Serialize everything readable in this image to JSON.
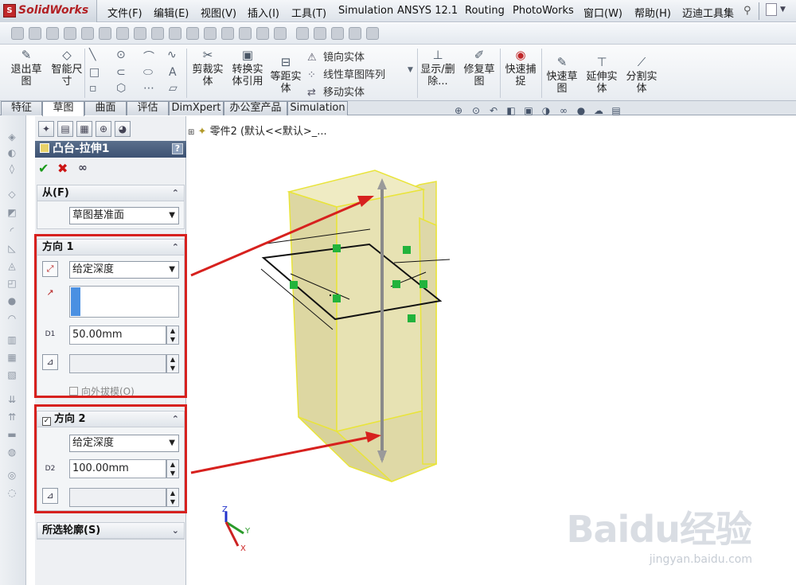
{
  "app": {
    "name": "SolidWorks",
    "logo_mark": "S"
  },
  "menu": [
    "文件(F)",
    "编辑(E)",
    "视图(V)",
    "插入(I)",
    "工具(T)",
    "Simulation",
    "ANSYS 12.1",
    "Routing",
    "PhotoWorks",
    "窗口(W)",
    "帮助(H)",
    "迈迪工具集"
  ],
  "command_manager": {
    "exit_sketch": "退出草图",
    "smart_dim": "智能尺寸",
    "trim": "剪裁实体",
    "convert": "转换实体引用",
    "offset": "等距实体",
    "mirror": "镜向实体",
    "linear_pattern": "线性草图阵列",
    "move": "移动实体",
    "display_delete": "显示/删除...",
    "repair": "修复草图",
    "quick_snap": "快速捕捉",
    "quick_sketch": "快速草图",
    "extend": "延伸实体",
    "split": "分割实体"
  },
  "tabs": [
    "特征",
    "草图",
    "曲面",
    "评估",
    "DimXpert",
    "办公室产品",
    "Simulation"
  ],
  "active_tab": "草图",
  "panel": {
    "title": "凸台-拉伸1",
    "help": "?",
    "from": {
      "header": "从(F)",
      "value": "草图基准面"
    },
    "dir1": {
      "header": "方向 1",
      "type": "给定深度",
      "depth": "50.00mm",
      "depth_icon_label": "D1",
      "draft_label": "向外拔模(O)"
    },
    "dir2": {
      "header": "方向 2",
      "type": "给定深度",
      "depth": "100.00mm",
      "depth_icon_label": "D2"
    },
    "selected_contours": {
      "header": "所选轮廓(S)"
    }
  },
  "tree": {
    "label": "零件2  (默认<<默认>_..."
  },
  "axes": {
    "x": "X",
    "y": "Y",
    "z": "Z"
  },
  "watermark": {
    "brand": "Baidu经验",
    "url": "jingyan.baidu.com"
  },
  "colors": {
    "highlight": "#d7211e",
    "part_fill": "#e7e2a6",
    "part_edge": "#e9e43a",
    "relation": "#22b33c"
  }
}
